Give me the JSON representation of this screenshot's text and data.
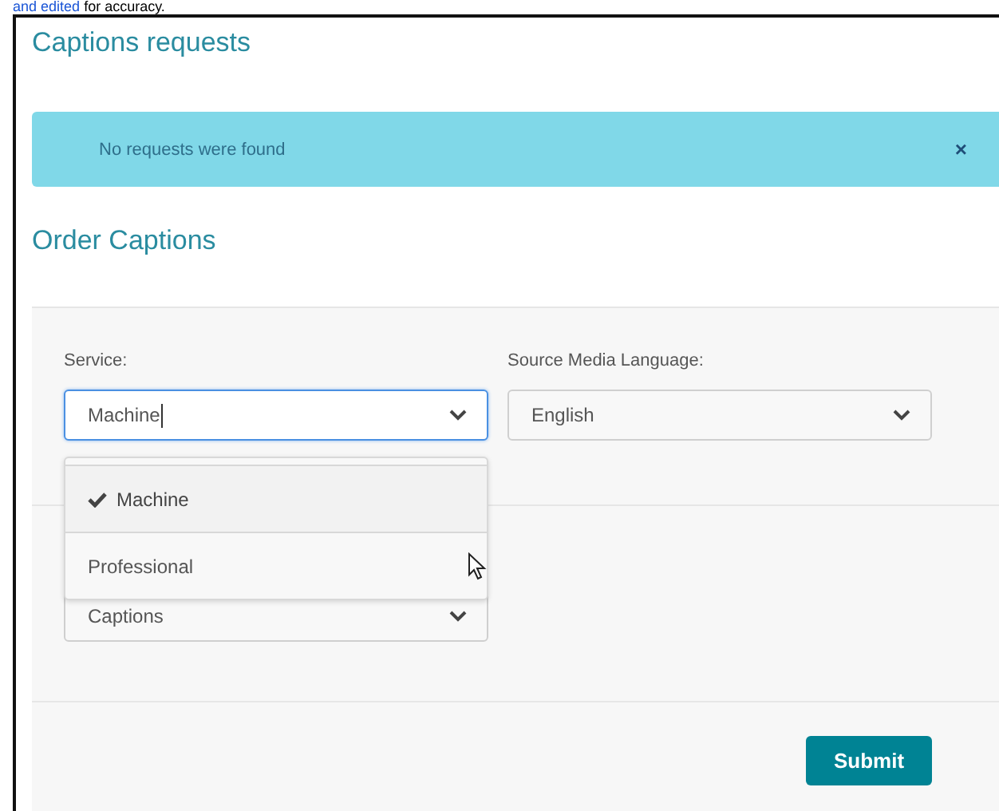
{
  "intro": {
    "link": "and edited",
    "text": "for accuracy."
  },
  "requests": {
    "title": "Captions requests",
    "alert": {
      "message": "No requests were found",
      "close": "×"
    }
  },
  "order": {
    "title": "Order Captions",
    "fields": [
      {
        "label": "Service:",
        "value": "Machine",
        "focused": true
      },
      {
        "label": "Source Media Language:",
        "value": "English",
        "focused": false
      }
    ],
    "dropdown": {
      "options": [
        {
          "label": "Machine",
          "selected": true
        },
        {
          "label": "Professional",
          "selected": false
        }
      ]
    },
    "type_select": {
      "value": "Captions"
    },
    "submit": "Submit"
  }
}
